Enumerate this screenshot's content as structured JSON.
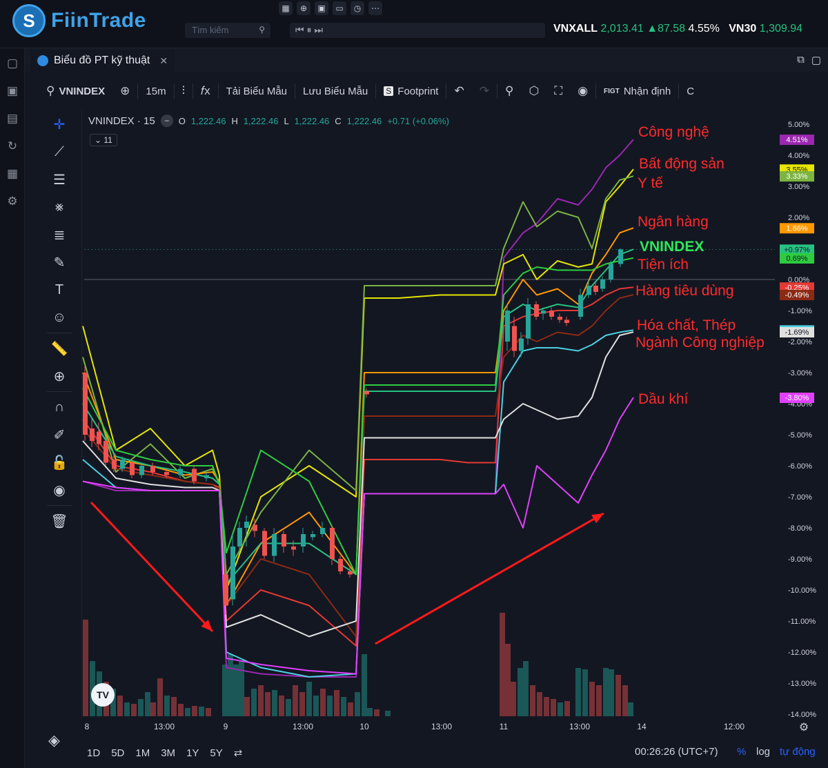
{
  "brand": {
    "name": "FiinTrade"
  },
  "search": {
    "placeholder": "Tìm kiếm"
  },
  "player": {
    "controls": "⏮ ⏸ ⏭"
  },
  "tickers": [
    {
      "name": "VNXALL",
      "price": "2,013.41",
      "change": "▲87.58",
      "pct": "4.55%"
    },
    {
      "name": "VN30",
      "price": "1,309.94"
    }
  ],
  "tab": {
    "title": "Biểu đồ PT kỹ thuật"
  },
  "toolbar": {
    "symbol": "VNINDEX",
    "interval": "15m",
    "load_template": "Tải Biểu Mẫu",
    "save_template": "Lưu Biểu Mẫu",
    "footprint": "Footprint",
    "assessment": "Nhận định",
    "assessment_badge": "FIGT",
    "truncated": "C"
  },
  "legend": {
    "title": "VNINDEX · 15",
    "o_label": "O",
    "o": "1,222.46",
    "h_label": "H",
    "h": "1,222.46",
    "l_label": "L",
    "l": "1,222.46",
    "c_label": "C",
    "c": "1,222.46",
    "change": "+0.71 (+0.06%)",
    "indicator_count": "11"
  },
  "bottom": {
    "ranges": [
      "1D",
      "5D",
      "1M",
      "3M",
      "1Y",
      "5Y"
    ],
    "clock": "00:26:26 (UTC+7)",
    "percent": "%",
    "log": "log",
    "auto": "tự động"
  },
  "chart_data": {
    "type": "line",
    "y_unit": "%",
    "ylim": [
      -14,
      5.5
    ],
    "y_ticks": [
      "5.00%",
      "4.00%",
      "3.00%",
      "2.00%",
      "1.00%",
      "0.00%",
      "-1.00%",
      "-2.00%",
      "-3.00%",
      "-4.00%",
      "-5.00%",
      "-6.00%",
      "-7.00%",
      "-8.00%",
      "-9.00%",
      "-10.00%",
      "-11.00%",
      "-12.00%",
      "-13.00%",
      "-14.00%"
    ],
    "x_ticks": [
      "8",
      "13:00",
      "9",
      "13:00",
      "10",
      "13:00",
      "11",
      "13:00",
      "14",
      "12:00"
    ],
    "series": [
      {
        "name": "Công nghệ",
        "color": "#9c27b0",
        "last": "4.51%",
        "values": [
          -6.5,
          -6.8,
          -6.8,
          -6.8,
          -6.8,
          -6.8,
          -12.5,
          -12.7,
          -12.8,
          -12.8,
          -6.9,
          -6.9,
          -6.9,
          -6.9,
          -6.9,
          0.7,
          1.5,
          1.8,
          2.6,
          2.4,
          2.9,
          3.6,
          4.0,
          4.51
        ]
      },
      {
        "name": "Bất động sản",
        "color": "#e6e600",
        "last": "3.55%",
        "values": [
          -1.5,
          -5.5,
          -4.8,
          -6.0,
          -5.5,
          -6.3,
          -10.0,
          -7.0,
          -6.0,
          -7.0,
          -0.6,
          -0.6,
          -0.5,
          -0.5,
          -0.5,
          0.5,
          0.8,
          0.0,
          0.6,
          0.4,
          0.5,
          2.5,
          3.0,
          3.55
        ]
      },
      {
        "name": "Y tế",
        "color": "#7cb342",
        "last": "3.33%",
        "values": [
          -2.5,
          -6.2,
          -5.3,
          -6.4,
          -6.1,
          -6.6,
          -9.5,
          -7.5,
          -5.5,
          -6.8,
          -0.2,
          -0.2,
          -0.2,
          -0.2,
          -0.2,
          1.0,
          2.5,
          1.7,
          2.2,
          2.0,
          1.0,
          2.6,
          3.2,
          3.33
        ]
      },
      {
        "name": "Ngân hàng",
        "color": "#ff9800",
        "last": "1.66%",
        "values": [
          -3.0,
          -5.8,
          -6.0,
          -6.3,
          -6.2,
          -6.5,
          -10.5,
          -8.5,
          -7.5,
          -9.5,
          -3.0,
          -3.0,
          -3.0,
          -3.0,
          -3.0,
          -1.0,
          0.0,
          -0.5,
          -0.3,
          -0.8,
          0.2,
          0.8,
          1.5,
          1.66
        ]
      },
      {
        "name": "VNINDEX",
        "color": "#26c281",
        "last": "+0.97%",
        "values": [
          -4.0,
          -5.7,
          -6.0,
          -6.2,
          -6.4,
          -6.6,
          -9.8,
          -8.5,
          -8.5,
          -9.5,
          -3.6,
          -3.6,
          -3.6,
          -3.6,
          -3.6,
          -1.2,
          -0.8,
          -1.0,
          -0.8,
          -0.9,
          -0.2,
          0.3,
          0.8,
          0.97
        ]
      },
      {
        "name": "Tiện ích",
        "color": "#2ecc40",
        "last": "0.69%",
        "values": [
          -3.5,
          -5.5,
          -5.8,
          -6.0,
          -6.0,
          -6.6,
          -8.8,
          -5.5,
          -6.5,
          -9.5,
          -3.4,
          -3.4,
          -3.4,
          -3.4,
          -3.4,
          -0.5,
          0.2,
          0.4,
          0.3,
          0.3,
          0.3,
          0.5,
          0.6,
          0.69
        ]
      },
      {
        "name": "Hàng tiêu dùng",
        "color": "#e53935",
        "last": "-0.25%",
        "values": [
          -4.5,
          -6.0,
          -6.2,
          -6.5,
          -6.6,
          -6.7,
          -11.0,
          -10.0,
          -10.5,
          -11.8,
          -5.8,
          -5.8,
          -5.8,
          -5.9,
          -5.9,
          -1.5,
          -1.2,
          -1.1,
          -1.0,
          -1.0,
          -0.8,
          -0.5,
          -0.3,
          -0.25
        ]
      },
      {
        "name": "Hàng tiêu dùng (2)",
        "color": "#8b2a14",
        "last": "-0.49%",
        "values": [
          -4.8,
          -6.1,
          -6.3,
          -6.5,
          -6.6,
          -6.8,
          -10.5,
          -9.0,
          -9.5,
          -11.5,
          -4.4,
          -4.4,
          -4.4,
          -4.4,
          -4.4,
          -2.5,
          -1.8,
          -2.0,
          -1.7,
          -1.8,
          -1.5,
          -1.0,
          -0.6,
          -0.49
        ]
      },
      {
        "name": "Hóa chất, Thép",
        "color": "#4dd0e1",
        "last": "-1.63%",
        "values": [
          -5.8,
          -6.7,
          -6.8,
          -6.8,
          -6.8,
          -6.8,
          -12.0,
          -12.5,
          -12.8,
          -12.7,
          -6.9,
          -6.9,
          -6.9,
          -6.9,
          -6.9,
          -3.3,
          -2.3,
          -2.2,
          -2.2,
          -2.3,
          -2.1,
          -1.8,
          -1.7,
          -1.63
        ]
      },
      {
        "name": "Ngành Công nghiệp",
        "color": "#e0e0e0",
        "last": "-1.69%",
        "values": [
          -5.2,
          -6.4,
          -6.6,
          -6.7,
          -6.7,
          -6.8,
          -11.2,
          -10.8,
          -11.5,
          -11.0,
          -5.1,
          -5.1,
          -5.1,
          -5.1,
          -5.1,
          -4.5,
          -4.0,
          -4.2,
          -4.5,
          -4.4,
          -3.8,
          -2.5,
          -1.8,
          -1.69
        ]
      },
      {
        "name": "Dầu khí",
        "color": "#e040fb",
        "last": "-3.80%",
        "values": [
          -6.5,
          -6.7,
          -6.8,
          -6.8,
          -6.8,
          -6.8,
          -12.2,
          -12.4,
          -12.6,
          -12.7,
          -6.9,
          -6.9,
          -6.9,
          -6.9,
          -6.9,
          -6.6,
          -8.0,
          -6.0,
          -6.6,
          -7.2,
          -6.3,
          -5.5,
          -4.5,
          -3.8
        ]
      }
    ]
  },
  "annotations": {
    "tech": "Công nghệ",
    "realestate": "Bất động sản",
    "health": "Y tế",
    "bank": "Ngân hàng",
    "vnindex": "VNINDEX",
    "utilities": "Tiện ích",
    "consumer": "Hàng tiêu dùng",
    "chem": "Hóa chất, Thép",
    "industry": "Ngành Công nghiệp",
    "oil": "Dầu khí"
  },
  "colors": {
    "accent": "#2962ff",
    "background": "#131722",
    "up": "#26a69a",
    "down": "#ef5350",
    "annotation": "#ff2b2b"
  }
}
